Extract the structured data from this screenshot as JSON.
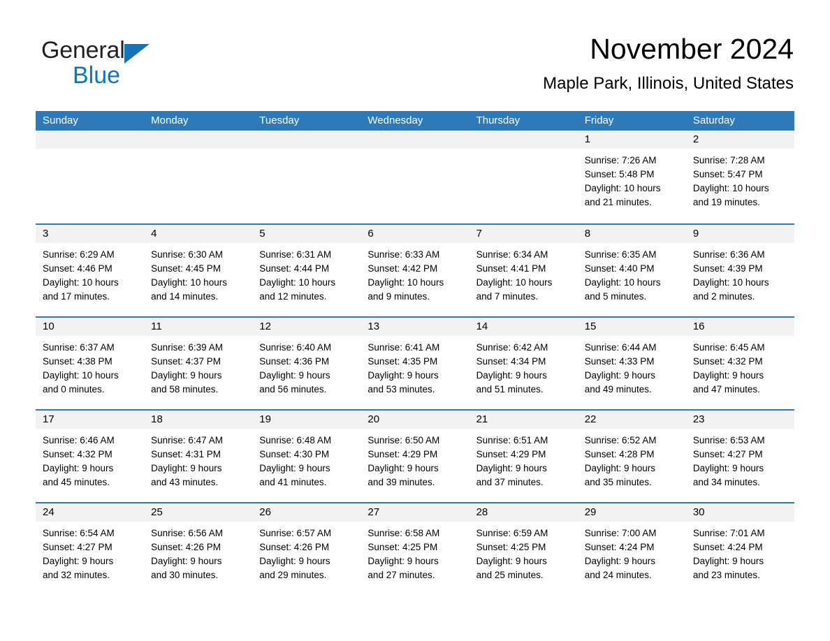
{
  "brand": {
    "word1": "General",
    "word2": "Blue",
    "triangle_color": "#1573ba",
    "blue_text_color": "#0b76c4"
  },
  "header": {
    "month_title": "November 2024",
    "location": "Maple Park, Illinois, United States"
  },
  "theme": {
    "header_blue": "#2e7ab8",
    "daynum_band": "#f2f2f2",
    "page_background": "#ffffff",
    "text_color": "#000000"
  },
  "calendar": {
    "weekday_headers": [
      "Sunday",
      "Monday",
      "Tuesday",
      "Wednesday",
      "Thursday",
      "Friday",
      "Saturday"
    ],
    "weeks": [
      [
        {
          "day": "",
          "empty": true,
          "sunrise": "",
          "sunset": "",
          "daylight_line1": "",
          "daylight_line2": ""
        },
        {
          "day": "",
          "empty": true,
          "sunrise": "",
          "sunset": "",
          "daylight_line1": "",
          "daylight_line2": ""
        },
        {
          "day": "",
          "empty": true,
          "sunrise": "",
          "sunset": "",
          "daylight_line1": "",
          "daylight_line2": ""
        },
        {
          "day": "",
          "empty": true,
          "sunrise": "",
          "sunset": "",
          "daylight_line1": "",
          "daylight_line2": ""
        },
        {
          "day": "",
          "empty": true,
          "sunrise": "",
          "sunset": "",
          "daylight_line1": "",
          "daylight_line2": ""
        },
        {
          "day": "1",
          "empty": false,
          "sunrise": "Sunrise: 7:26 AM",
          "sunset": "Sunset: 5:48 PM",
          "daylight_line1": "Daylight: 10 hours",
          "daylight_line2": "and 21 minutes."
        },
        {
          "day": "2",
          "empty": false,
          "sunrise": "Sunrise: 7:28 AM",
          "sunset": "Sunset: 5:47 PM",
          "daylight_line1": "Daylight: 10 hours",
          "daylight_line2": "and 19 minutes."
        }
      ],
      [
        {
          "day": "3",
          "empty": false,
          "sunrise": "Sunrise: 6:29 AM",
          "sunset": "Sunset: 4:46 PM",
          "daylight_line1": "Daylight: 10 hours",
          "daylight_line2": "and 17 minutes."
        },
        {
          "day": "4",
          "empty": false,
          "sunrise": "Sunrise: 6:30 AM",
          "sunset": "Sunset: 4:45 PM",
          "daylight_line1": "Daylight: 10 hours",
          "daylight_line2": "and 14 minutes."
        },
        {
          "day": "5",
          "empty": false,
          "sunrise": "Sunrise: 6:31 AM",
          "sunset": "Sunset: 4:44 PM",
          "daylight_line1": "Daylight: 10 hours",
          "daylight_line2": "and 12 minutes."
        },
        {
          "day": "6",
          "empty": false,
          "sunrise": "Sunrise: 6:33 AM",
          "sunset": "Sunset: 4:42 PM",
          "daylight_line1": "Daylight: 10 hours",
          "daylight_line2": "and 9 minutes."
        },
        {
          "day": "7",
          "empty": false,
          "sunrise": "Sunrise: 6:34 AM",
          "sunset": "Sunset: 4:41 PM",
          "daylight_line1": "Daylight: 10 hours",
          "daylight_line2": "and 7 minutes."
        },
        {
          "day": "8",
          "empty": false,
          "sunrise": "Sunrise: 6:35 AM",
          "sunset": "Sunset: 4:40 PM",
          "daylight_line1": "Daylight: 10 hours",
          "daylight_line2": "and 5 minutes."
        },
        {
          "day": "9",
          "empty": false,
          "sunrise": "Sunrise: 6:36 AM",
          "sunset": "Sunset: 4:39 PM",
          "daylight_line1": "Daylight: 10 hours",
          "daylight_line2": "and 2 minutes."
        }
      ],
      [
        {
          "day": "10",
          "empty": false,
          "sunrise": "Sunrise: 6:37 AM",
          "sunset": "Sunset: 4:38 PM",
          "daylight_line1": "Daylight: 10 hours",
          "daylight_line2": "and 0 minutes."
        },
        {
          "day": "11",
          "empty": false,
          "sunrise": "Sunrise: 6:39 AM",
          "sunset": "Sunset: 4:37 PM",
          "daylight_line1": "Daylight: 9 hours",
          "daylight_line2": "and 58 minutes."
        },
        {
          "day": "12",
          "empty": false,
          "sunrise": "Sunrise: 6:40 AM",
          "sunset": "Sunset: 4:36 PM",
          "daylight_line1": "Daylight: 9 hours",
          "daylight_line2": "and 56 minutes."
        },
        {
          "day": "13",
          "empty": false,
          "sunrise": "Sunrise: 6:41 AM",
          "sunset": "Sunset: 4:35 PM",
          "daylight_line1": "Daylight: 9 hours",
          "daylight_line2": "and 53 minutes."
        },
        {
          "day": "14",
          "empty": false,
          "sunrise": "Sunrise: 6:42 AM",
          "sunset": "Sunset: 4:34 PM",
          "daylight_line1": "Daylight: 9 hours",
          "daylight_line2": "and 51 minutes."
        },
        {
          "day": "15",
          "empty": false,
          "sunrise": "Sunrise: 6:44 AM",
          "sunset": "Sunset: 4:33 PM",
          "daylight_line1": "Daylight: 9 hours",
          "daylight_line2": "and 49 minutes."
        },
        {
          "day": "16",
          "empty": false,
          "sunrise": "Sunrise: 6:45 AM",
          "sunset": "Sunset: 4:32 PM",
          "daylight_line1": "Daylight: 9 hours",
          "daylight_line2": "and 47 minutes."
        }
      ],
      [
        {
          "day": "17",
          "empty": false,
          "sunrise": "Sunrise: 6:46 AM",
          "sunset": "Sunset: 4:32 PM",
          "daylight_line1": "Daylight: 9 hours",
          "daylight_line2": "and 45 minutes."
        },
        {
          "day": "18",
          "empty": false,
          "sunrise": "Sunrise: 6:47 AM",
          "sunset": "Sunset: 4:31 PM",
          "daylight_line1": "Daylight: 9 hours",
          "daylight_line2": "and 43 minutes."
        },
        {
          "day": "19",
          "empty": false,
          "sunrise": "Sunrise: 6:48 AM",
          "sunset": "Sunset: 4:30 PM",
          "daylight_line1": "Daylight: 9 hours",
          "daylight_line2": "and 41 minutes."
        },
        {
          "day": "20",
          "empty": false,
          "sunrise": "Sunrise: 6:50 AM",
          "sunset": "Sunset: 4:29 PM",
          "daylight_line1": "Daylight: 9 hours",
          "daylight_line2": "and 39 minutes."
        },
        {
          "day": "21",
          "empty": false,
          "sunrise": "Sunrise: 6:51 AM",
          "sunset": "Sunset: 4:29 PM",
          "daylight_line1": "Daylight: 9 hours",
          "daylight_line2": "and 37 minutes."
        },
        {
          "day": "22",
          "empty": false,
          "sunrise": "Sunrise: 6:52 AM",
          "sunset": "Sunset: 4:28 PM",
          "daylight_line1": "Daylight: 9 hours",
          "daylight_line2": "and 35 minutes."
        },
        {
          "day": "23",
          "empty": false,
          "sunrise": "Sunrise: 6:53 AM",
          "sunset": "Sunset: 4:27 PM",
          "daylight_line1": "Daylight: 9 hours",
          "daylight_line2": "and 34 minutes."
        }
      ],
      [
        {
          "day": "24",
          "empty": false,
          "sunrise": "Sunrise: 6:54 AM",
          "sunset": "Sunset: 4:27 PM",
          "daylight_line1": "Daylight: 9 hours",
          "daylight_line2": "and 32 minutes."
        },
        {
          "day": "25",
          "empty": false,
          "sunrise": "Sunrise: 6:56 AM",
          "sunset": "Sunset: 4:26 PM",
          "daylight_line1": "Daylight: 9 hours",
          "daylight_line2": "and 30 minutes."
        },
        {
          "day": "26",
          "empty": false,
          "sunrise": "Sunrise: 6:57 AM",
          "sunset": "Sunset: 4:26 PM",
          "daylight_line1": "Daylight: 9 hours",
          "daylight_line2": "and 29 minutes."
        },
        {
          "day": "27",
          "empty": false,
          "sunrise": "Sunrise: 6:58 AM",
          "sunset": "Sunset: 4:25 PM",
          "daylight_line1": "Daylight: 9 hours",
          "daylight_line2": "and 27 minutes."
        },
        {
          "day": "28",
          "empty": false,
          "sunrise": "Sunrise: 6:59 AM",
          "sunset": "Sunset: 4:25 PM",
          "daylight_line1": "Daylight: 9 hours",
          "daylight_line2": "and 25 minutes."
        },
        {
          "day": "29",
          "empty": false,
          "sunrise": "Sunrise: 7:00 AM",
          "sunset": "Sunset: 4:24 PM",
          "daylight_line1": "Daylight: 9 hours",
          "daylight_line2": "and 24 minutes."
        },
        {
          "day": "30",
          "empty": false,
          "sunrise": "Sunrise: 7:01 AM",
          "sunset": "Sunset: 4:24 PM",
          "daylight_line1": "Daylight: 9 hours",
          "daylight_line2": "and 23 minutes."
        }
      ]
    ]
  }
}
